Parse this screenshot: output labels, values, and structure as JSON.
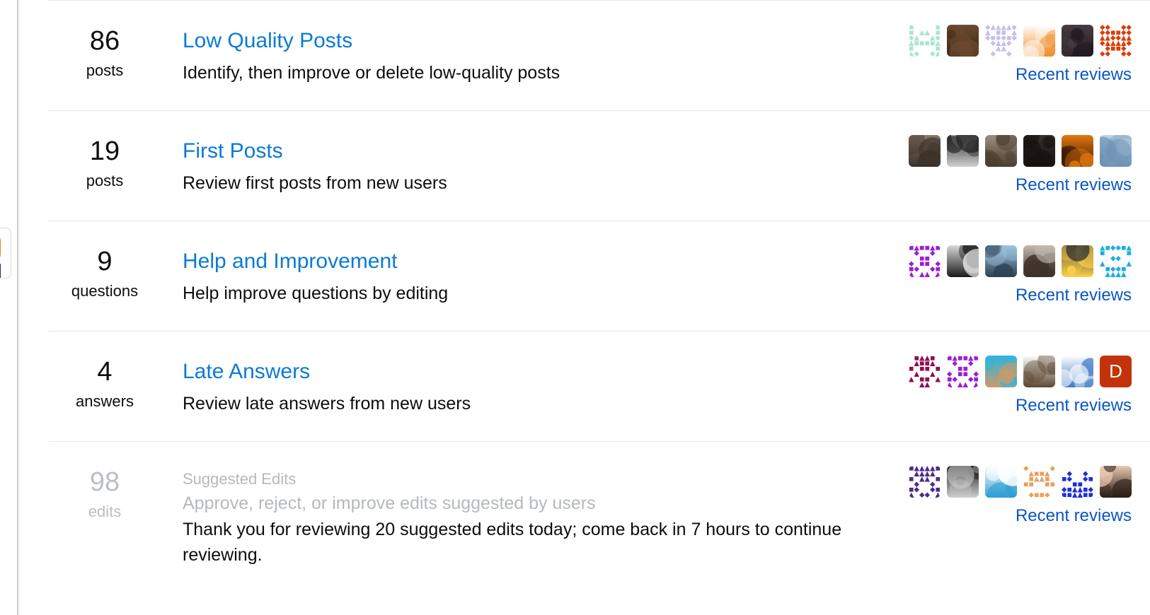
{
  "page": {
    "accent_link_color": "#0a7bd4",
    "recent_link_color": "#0a56c4",
    "divider_color": "#e3e6e8",
    "disabled_text_color": "#b5b9bd",
    "recent_reviews_label": "Recent reviews"
  },
  "queues": [
    {
      "count": "86",
      "unit": "posts",
      "title": "Low Quality Posts",
      "description": "Identify, then improve or delete low-quality posts",
      "note": "",
      "disabled": false,
      "recent_reviews_label": "Recent reviews",
      "avatars": [
        {
          "name": "identicon-mint-grid",
          "kind": "identicon",
          "colors": [
            "#a8e6cf",
            "#ffffff"
          ],
          "seed": 11
        },
        {
          "name": "gears-photo",
          "kind": "photo",
          "colors": [
            "#6b4a2f",
            "#3a2716"
          ],
          "seed": 2
        },
        {
          "name": "identicon-lavender-star",
          "kind": "identicon",
          "colors": [
            "#c5c0e8",
            "#ffffff"
          ],
          "seed": 23
        },
        {
          "name": "octocat-portal-avatar",
          "kind": "photo",
          "colors": [
            "#ffffff",
            "#f28c28"
          ],
          "seed": 3
        },
        {
          "name": "user-photo-glasses",
          "kind": "photo",
          "colors": [
            "#4a3b44",
            "#211a20"
          ],
          "seed": 4
        },
        {
          "name": "identicon-orange-diamond",
          "kind": "identicon",
          "colors": [
            "#dd3d0a",
            "#ffffff"
          ],
          "seed": 37
        }
      ]
    },
    {
      "count": "19",
      "unit": "posts",
      "title": "First Posts",
      "description": "Review first posts from new users",
      "note": "",
      "disabled": false,
      "recent_reviews_label": "Recent reviews",
      "avatars": [
        {
          "name": "user-photo-suit",
          "kind": "photo",
          "colors": [
            "#8a7a68",
            "#3b3129"
          ],
          "seed": 5
        },
        {
          "name": "coffee-cup-photo",
          "kind": "photo",
          "colors": [
            "#2a2a2a",
            "#cfcfcf"
          ],
          "seed": 6
        },
        {
          "name": "user-photo-young-man",
          "kind": "photo",
          "colors": [
            "#9d8f80",
            "#4b3c2e"
          ],
          "seed": 7
        },
        {
          "name": "user-photo-dark",
          "kind": "photo",
          "colors": [
            "#38302b",
            "#17120f"
          ],
          "seed": 8
        },
        {
          "name": "fire-photo",
          "kind": "photo",
          "colors": [
            "#e2760e",
            "#3a1a05"
          ],
          "seed": 9
        },
        {
          "name": "ice-landscape-photo",
          "kind": "photo",
          "colors": [
            "#bcd4e6",
            "#6e93b5"
          ],
          "seed": 10
        }
      ]
    },
    {
      "count": "9",
      "unit": "questions",
      "title": "Help and Improvement",
      "description": "Help improve questions by editing",
      "note": "",
      "disabled": false,
      "recent_reviews_label": "Recent reviews",
      "avatars": [
        {
          "name": "identicon-purple-mandala",
          "kind": "identicon",
          "colors": [
            "#9c1ed4",
            "#ffffff"
          ],
          "seed": 41
        },
        {
          "name": "floppy-disk-icon-avatar",
          "kind": "photo",
          "colors": [
            "#d8d8d8",
            "#1a1a1a"
          ],
          "seed": 12
        },
        {
          "name": "snow-landscape-photo",
          "kind": "photo",
          "colors": [
            "#9cc2de",
            "#2c4154"
          ],
          "seed": 13
        },
        {
          "name": "user-photo-car",
          "kind": "photo",
          "colors": [
            "#c3b9ad",
            "#3c3129"
          ],
          "seed": 14
        },
        {
          "name": "lightbulb-braces-logo",
          "kind": "photo",
          "colors": [
            "#1d2330",
            "#ffd24a"
          ],
          "seed": 15
        },
        {
          "name": "identicon-cyan-grid",
          "kind": "identicon",
          "colors": [
            "#1eaee0",
            "#ffffff"
          ],
          "seed": 29
        }
      ]
    },
    {
      "count": "4",
      "unit": "answers",
      "title": "Late Answers",
      "description": "Review late answers from new users",
      "note": "",
      "disabled": false,
      "recent_reviews_label": "Recent reviews",
      "avatars": [
        {
          "name": "identicon-magenta-weave",
          "kind": "identicon",
          "colors": [
            "#8e1050",
            "#ffffff"
          ],
          "seed": 53
        },
        {
          "name": "identicon-violet-mandala",
          "kind": "identicon",
          "colors": [
            "#9c1ed4",
            "#ffffff"
          ],
          "seed": 41
        },
        {
          "name": "pool-photo",
          "kind": "photo",
          "colors": [
            "#2bb6e0",
            "#c99a6b"
          ],
          "seed": 16
        },
        {
          "name": "cartoon-face-avatar",
          "kind": "photo",
          "colors": [
            "#ffffff",
            "#5b4632"
          ],
          "seed": 17
        },
        {
          "name": "blue-puzzle-logo",
          "kind": "photo",
          "colors": [
            "#ffffff",
            "#3a78c2"
          ],
          "seed": 18
        },
        {
          "name": "letter-avatar-d",
          "kind": "letter",
          "letter": "D",
          "colors": [
            "#c4320a",
            "#ffffff"
          ],
          "seed": 19
        }
      ]
    },
    {
      "count": "98",
      "unit": "edits",
      "title": "Suggested Edits",
      "description": "Approve, reject, or improve edits suggested by users",
      "note": "Thank you for reviewing 20 suggested edits today; come back in 7 hours to continue reviewing.",
      "disabled": true,
      "recent_reviews_label": "Recent reviews",
      "avatars": [
        {
          "name": "identicon-indigo-blocks",
          "kind": "identicon",
          "colors": [
            "#4b2d8c",
            "#ffffff"
          ],
          "seed": 61
        },
        {
          "name": "bw-child-photo",
          "kind": "photo",
          "colors": [
            "#1a1a1a",
            "#cfcfcf"
          ],
          "seed": 20
        },
        {
          "name": "bird-line-drawing",
          "kind": "photo",
          "colors": [
            "#ffffff",
            "#2f9fd4"
          ],
          "seed": 21
        },
        {
          "name": "identicon-orange-arrows",
          "kind": "identicon",
          "colors": [
            "#e8a060",
            "#ffffff"
          ],
          "seed": 67
        },
        {
          "name": "identicon-blue-diamond",
          "kind": "identicon",
          "colors": [
            "#1e2fd4",
            "#ffffff"
          ],
          "seed": 71
        },
        {
          "name": "baby-photo",
          "kind": "photo",
          "colors": [
            "#e8c8b0",
            "#2a1d16"
          ],
          "seed": 22
        }
      ]
    }
  ]
}
